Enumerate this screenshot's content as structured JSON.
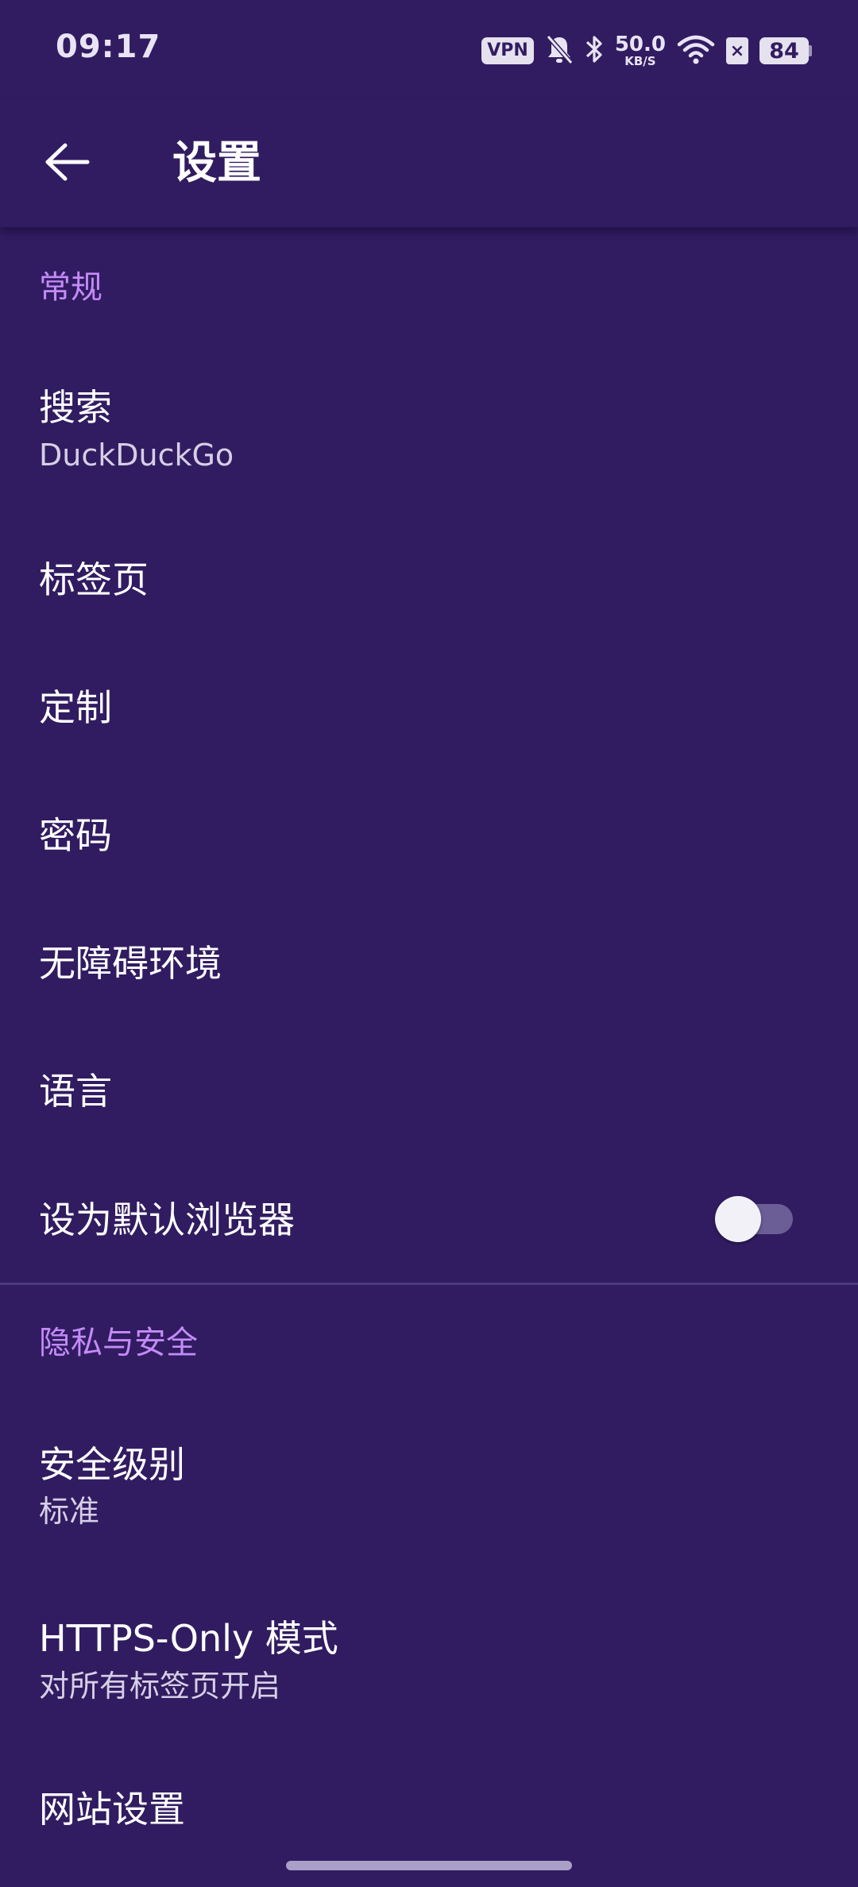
{
  "status_bar": {
    "time": "09:17",
    "vpn": "VPN",
    "speed_value": "50.0",
    "speed_unit": "KB/S",
    "battery": "84"
  },
  "app_bar": {
    "title": "设置",
    "back_icon": "arrow-left-icon"
  },
  "sections": {
    "general": {
      "header": "常规",
      "search": {
        "title": "搜索",
        "subtitle": "DuckDuckGo"
      },
      "tabs": {
        "title": "标签页"
      },
      "customize": {
        "title": "定制"
      },
      "passwords": {
        "title": "密码"
      },
      "accessibility": {
        "title": "无障碍环境"
      },
      "language": {
        "title": "语言"
      },
      "default_browser": {
        "title": "设为默认浏览器",
        "enabled": false
      }
    },
    "privacy": {
      "header": "隐私与安全",
      "security_level": {
        "title": "安全级别",
        "subtitle": "标准"
      },
      "https_only": {
        "title": "HTTPS-Only 模式",
        "subtitle": "对所有标签页开启"
      },
      "site_settings": {
        "title": "网站设置"
      }
    }
  },
  "colors": {
    "background": "#311c61",
    "section_header": "#c48bf7",
    "text": "#ffffff",
    "subtitle": "#d6cfe6"
  }
}
